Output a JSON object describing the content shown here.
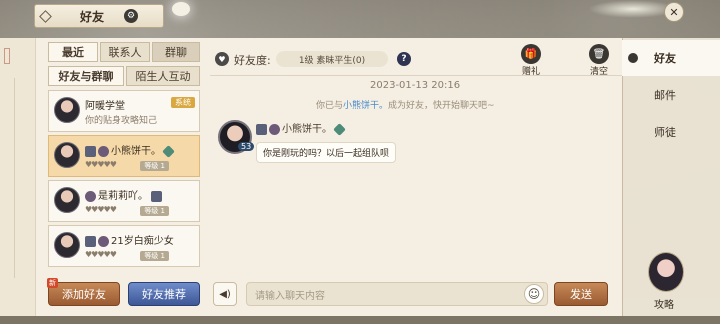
{
  "header": {
    "title": "好友"
  },
  "tabs": {
    "recent": "最近",
    "contacts": "联系人",
    "groups": "群聊",
    "friends_groups": "好友与群聊",
    "strangers": "陌生人互动"
  },
  "friends": [
    {
      "name": "阿暖学堂",
      "sub": "你的贴身攻略知己",
      "badge": "系统"
    },
    {
      "name": "小熊饼干。",
      "hearts": "♥♥♥♥♥",
      "level": "等级 1"
    },
    {
      "name": "是莉莉吖。",
      "hearts": "♥♥♥♥♥",
      "level": "等级 1"
    },
    {
      "name": "21岁白痴少女",
      "hearts": "♥♥♥♥♥",
      "level": "等级 1"
    }
  ],
  "buttons": {
    "add_friend": "添加好友",
    "add_friend_badge": "新",
    "recommend": "好友推荐",
    "send": "发送"
  },
  "chat": {
    "intimacy_label": "好友度:",
    "intimacy_value": "1级 素昧平生(0)",
    "help": "?",
    "gift_label": "赠礼",
    "clear_label": "清空",
    "timestamp": "2023-01-13 20:16",
    "system_prefix": "你已与",
    "system_name": "小熊饼干。",
    "system_suffix": "成为好友，快开始聊天吧~",
    "sender_name": "小熊饼干。",
    "sender_level": "53",
    "message": "你是刚玩的吗？以后一起组队呗",
    "input_placeholder": "请输入聊天内容"
  },
  "nav": {
    "friends": "好友",
    "mail": "邮件",
    "mentor": "师徒",
    "guide": "攻略"
  }
}
